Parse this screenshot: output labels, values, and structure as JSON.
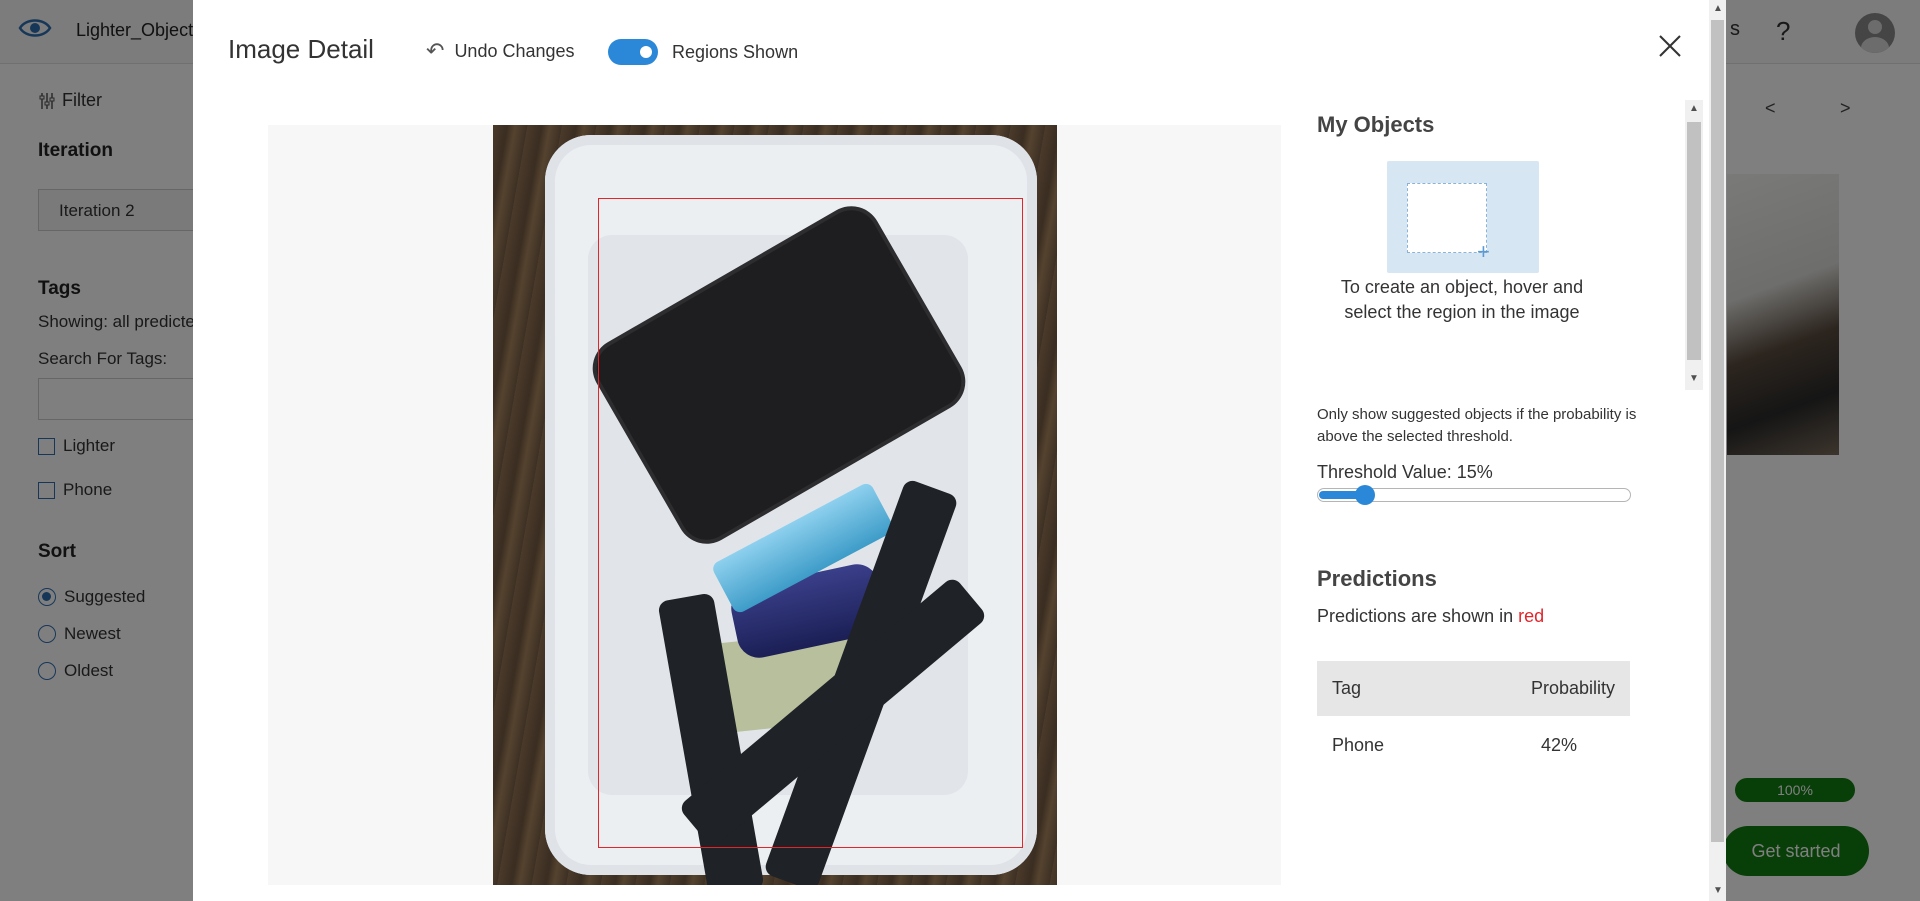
{
  "app": {
    "project_name": "Lighter_Object",
    "help_label": "?",
    "topbar_partial": "s"
  },
  "sidebar": {
    "filter_label": "Filter",
    "iteration_heading": "Iteration",
    "iteration_value": "Iteration 2",
    "tags_heading": "Tags",
    "showing_text": "Showing: all predicte",
    "search_label": "Search For Tags:",
    "tags": [
      {
        "label": "Lighter",
        "checked": false
      },
      {
        "label": "Phone",
        "checked": false
      }
    ],
    "sort_heading": "Sort",
    "sort_options": [
      {
        "label": "Suggested",
        "selected": true
      },
      {
        "label": "Newest",
        "selected": false
      },
      {
        "label": "Oldest",
        "selected": false
      }
    ]
  },
  "background": {
    "pager_prev": "<",
    "pager_next": ">",
    "progress_label": "100%",
    "get_started_label": "Get started"
  },
  "modal": {
    "title": "Image Detail",
    "undo_label": "Undo Changes",
    "regions_label": "Regions Shown",
    "regions_on": true,
    "my_objects": {
      "title": "My Objects",
      "hint": "To create an object, hover and select the region in the image"
    },
    "threshold": {
      "note": "Only show suggested objects if the probability is above the selected threshold.",
      "label": "Threshold Value: 15%",
      "value_percent": 15
    },
    "predictions": {
      "title": "Predictions",
      "note_prefix": "Predictions are shown in ",
      "note_color_word": "red",
      "columns": [
        "Tag",
        "Probability"
      ],
      "rows": [
        {
          "tag": "Phone",
          "probability": "42%"
        }
      ]
    }
  },
  "colors": {
    "accent": "#2b88d8",
    "prediction_box": "#e0262b",
    "success": "#107c10"
  }
}
